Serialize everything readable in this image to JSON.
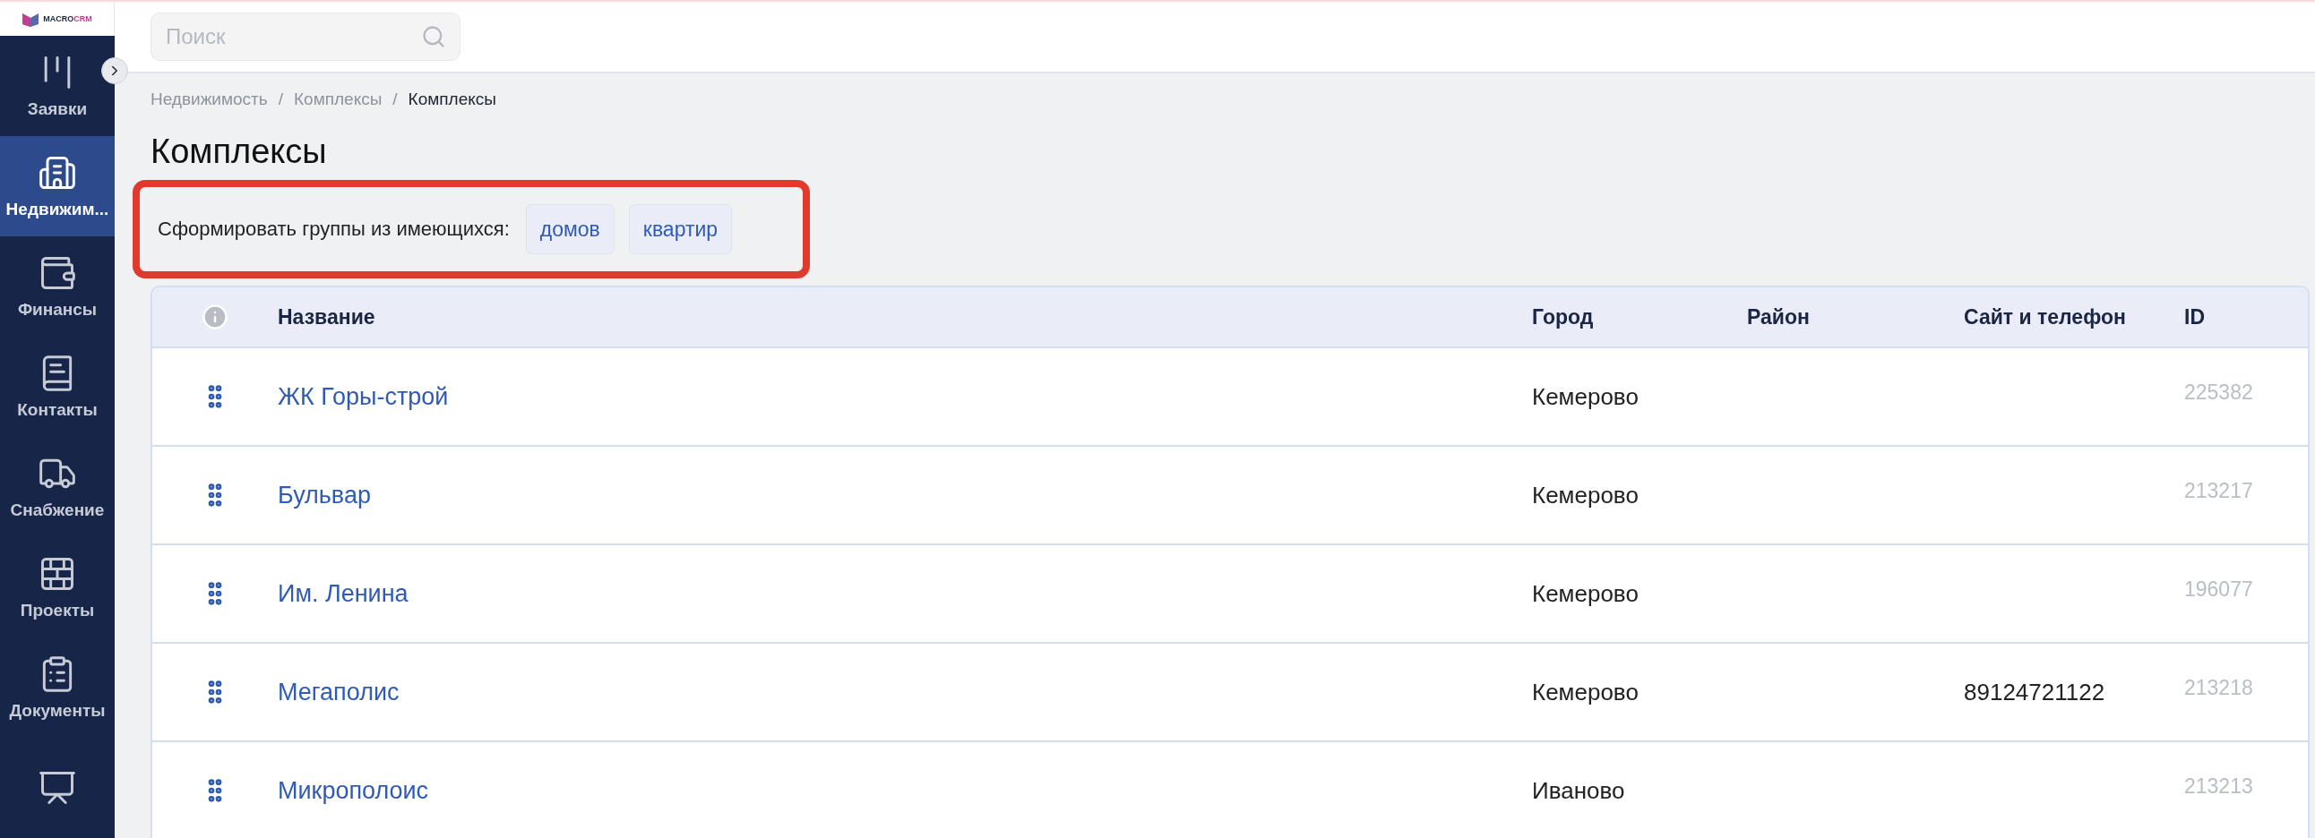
{
  "logo": {
    "part_1": "MACRO",
    "part_2": "CRM"
  },
  "sidebar": {
    "items": [
      {
        "label": "Заявки",
        "selected": false
      },
      {
        "label": "Недвижим...",
        "selected": true
      },
      {
        "label": "Финансы",
        "selected": false
      },
      {
        "label": "Контакты",
        "selected": false
      },
      {
        "label": "Снабжение",
        "selected": false
      },
      {
        "label": "Проекты",
        "selected": false
      },
      {
        "label": "Документы",
        "selected": false
      },
      {
        "selected": false
      }
    ]
  },
  "search": {
    "placeholder": "Поиск"
  },
  "breadcrumbs": [
    "Недвижимость",
    "Комплексы",
    "Комплексы"
  ],
  "breadcrumb_separator": "/",
  "title": "Комплексы",
  "groups_bar": {
    "label": "Сформировать группы из имеющихся:",
    "buttons": [
      "домов",
      "квартир"
    ]
  },
  "table": {
    "columns": [
      "Название",
      "Город",
      "Район",
      "Сайт и телефон",
      "ID"
    ],
    "rows": [
      {
        "name": "ЖК Горы-строй",
        "city": "Кемерово",
        "id": "225382"
      },
      {
        "name": "Бульвар",
        "city": "Кемерово",
        "id": "213217"
      },
      {
        "name": "Им. Ленина",
        "city": "Кемерово",
        "id": "196077"
      },
      {
        "name": "Мегаполис",
        "city": "Кемерово",
        "site": "89124721122",
        "id": "213218"
      },
      {
        "name": "Микрополоис",
        "city": "Иваново",
        "id": "213213"
      }
    ]
  }
}
